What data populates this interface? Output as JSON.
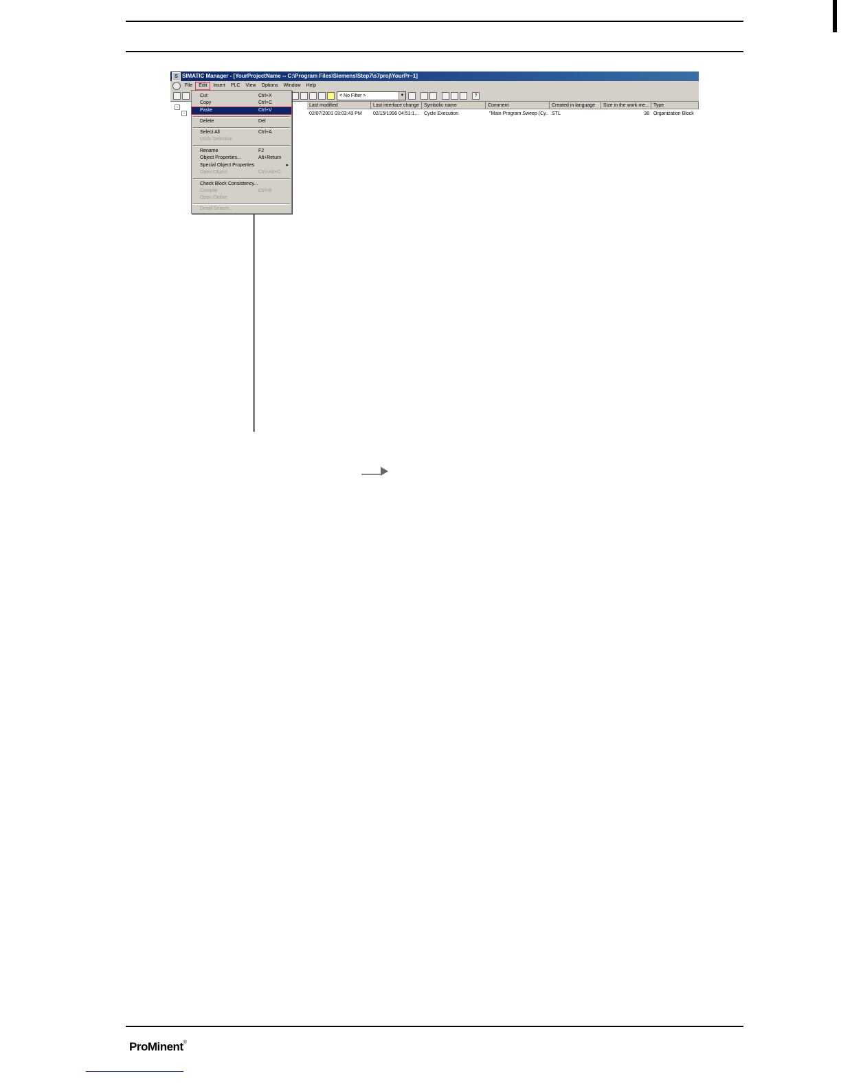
{
  "window": {
    "title": "SIMATIC Manager - [YourProjectName -- C:\\Program Files\\Siemens\\Step7\\s7proj\\YourPr~1]"
  },
  "menubar": {
    "items": [
      "File",
      "Edit",
      "Insert",
      "PLC",
      "View",
      "Options",
      "Window",
      "Help"
    ],
    "active": "Edit"
  },
  "toolbar": {
    "filter_value": "< No Filter >"
  },
  "table": {
    "columns": [
      "Last modified",
      "Last interface change",
      "Symbolic name",
      "Comment",
      "Created in language",
      "Size in the work me...",
      "Type"
    ],
    "row": [
      "02/07/2001 03:03:43 PM",
      "02/15/1996 04:51:1...",
      "Cycle Execution",
      "\"Main Program Sweep (Cy...",
      "STL",
      "38",
      "Organization Block"
    ]
  },
  "edit_menu": {
    "items": [
      {
        "label": "Cut",
        "shortcut": "Ctrl+X",
        "state": "enabled"
      },
      {
        "label": "Copy",
        "shortcut": "Ctrl+C",
        "state": "enabled"
      },
      {
        "label": "Paste",
        "shortcut": "Ctrl+V",
        "state": "highlighted"
      },
      {
        "label": "Delete",
        "shortcut": "Del",
        "state": "enabled"
      },
      {
        "label": "Select All",
        "shortcut": "Ctrl+A",
        "state": "enabled"
      },
      {
        "label": "Undo Selection",
        "shortcut": "",
        "state": "disabled"
      },
      {
        "label": "Rename",
        "shortcut": "F2",
        "state": "enabled"
      },
      {
        "label": "Object Properties...",
        "shortcut": "Alt+Return",
        "state": "enabled"
      },
      {
        "label": "Special Object Properties",
        "shortcut": "",
        "state": "enabled"
      },
      {
        "label": "Open Object",
        "shortcut": "Ctrl+Alt+O",
        "state": "disabled"
      },
      {
        "label": "Check Block Consistency...",
        "shortcut": "",
        "state": "enabled"
      },
      {
        "label": "Compile",
        "shortcut": "Ctrl+B",
        "state": "disabled"
      },
      {
        "label": "Open Online",
        "shortcut": "",
        "state": "disabled"
      },
      {
        "label": "Detail Search...",
        "shortcut": "",
        "state": "disabled"
      }
    ]
  },
  "footer": {
    "logo_text": "ProMinent",
    "logo_mark": "®"
  }
}
